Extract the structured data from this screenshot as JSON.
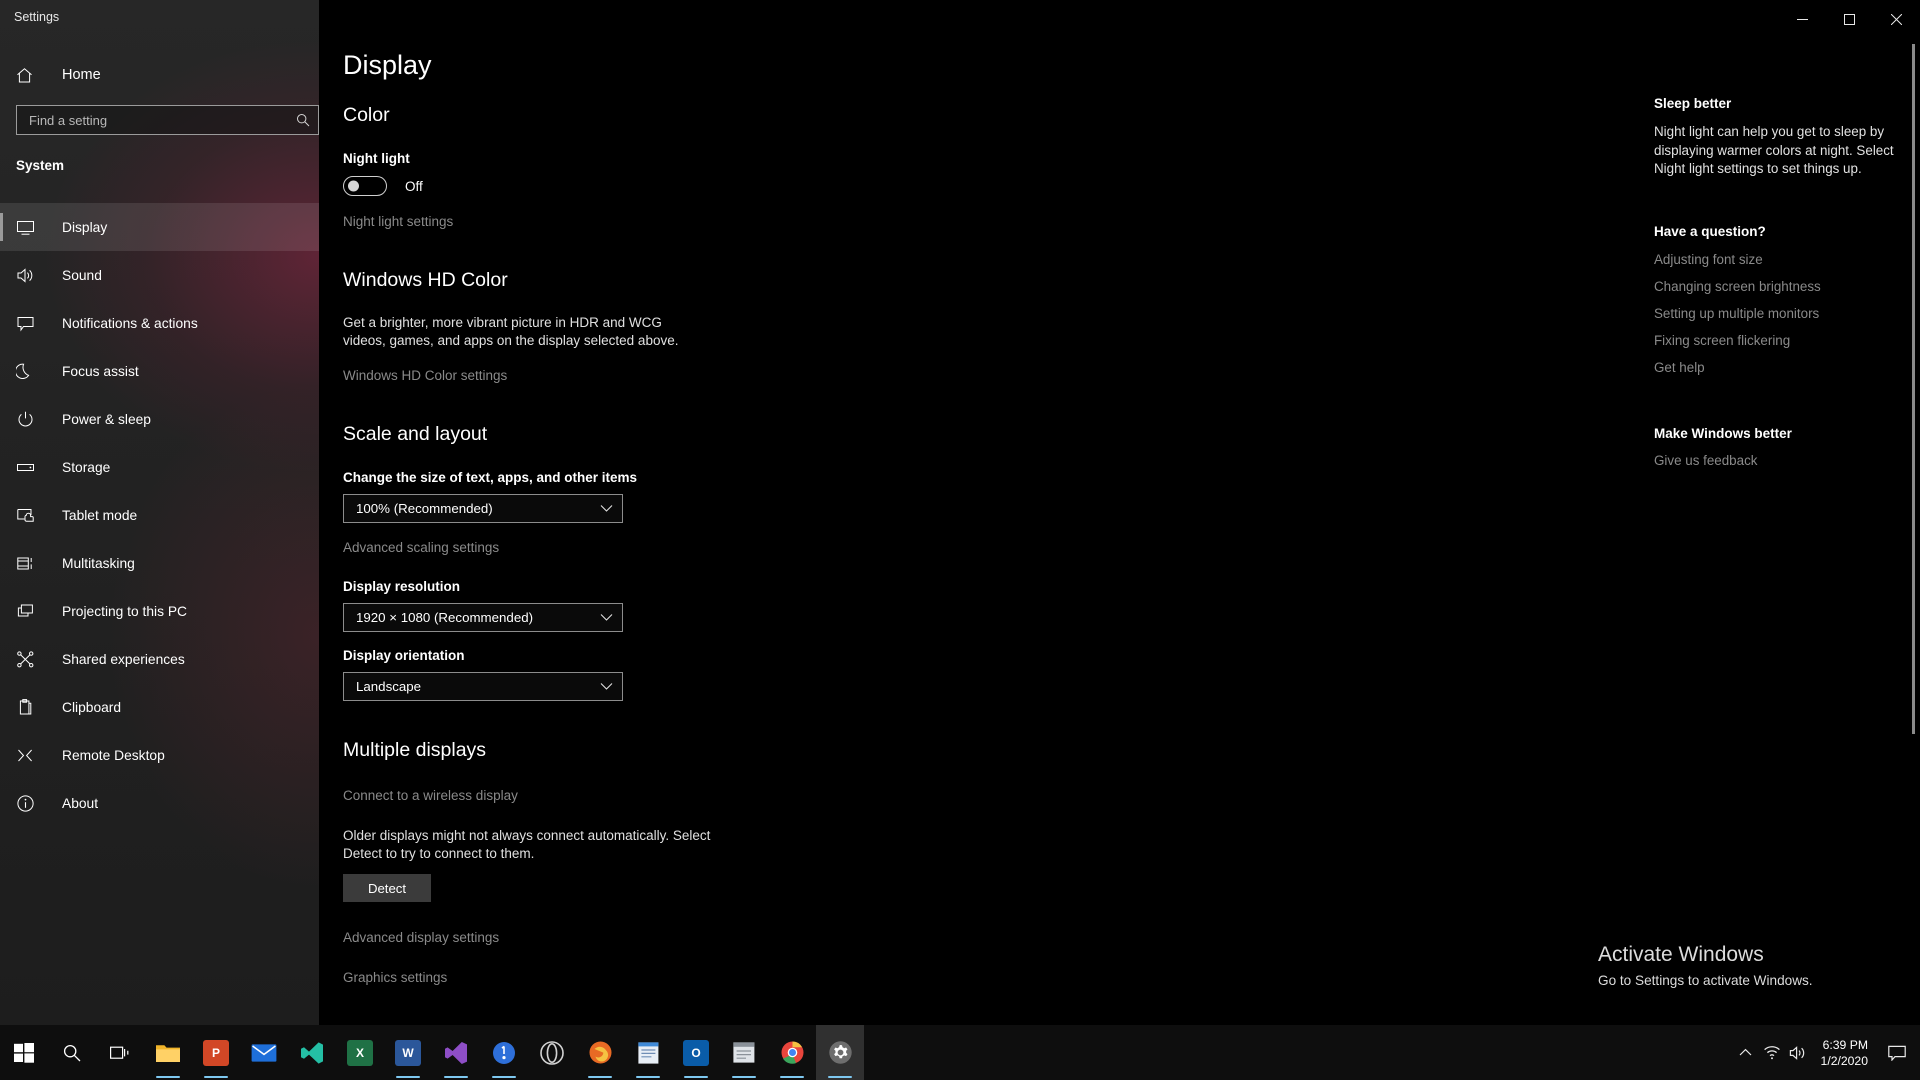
{
  "window": {
    "title": "Settings",
    "buttons": {
      "minimize": "minimize-icon",
      "maximize": "maximize-icon",
      "close": "close-icon"
    }
  },
  "sidebar": {
    "home_label": "Home",
    "home_icon": "home-icon",
    "search": {
      "placeholder": "Find a setting",
      "value": "",
      "icon": "search-icon"
    },
    "group_header": "System",
    "items": [
      {
        "label": "Display",
        "icon": "monitor-icon",
        "selected": true
      },
      {
        "label": "Sound",
        "icon": "speaker-icon",
        "selected": false
      },
      {
        "label": "Notifications & actions",
        "icon": "notification-icon",
        "selected": false
      },
      {
        "label": "Focus assist",
        "icon": "moon-icon",
        "selected": false
      },
      {
        "label": "Power & sleep",
        "icon": "power-icon",
        "selected": false
      },
      {
        "label": "Storage",
        "icon": "storage-icon",
        "selected": false
      },
      {
        "label": "Tablet mode",
        "icon": "tablet-icon",
        "selected": false
      },
      {
        "label": "Multitasking",
        "icon": "multitasking-icon",
        "selected": false
      },
      {
        "label": "Projecting to this PC",
        "icon": "projecting-icon",
        "selected": false
      },
      {
        "label": "Shared experiences",
        "icon": "shared-icon",
        "selected": false
      },
      {
        "label": "Clipboard",
        "icon": "clipboard-icon",
        "selected": false
      },
      {
        "label": "Remote Desktop",
        "icon": "remote-desktop-icon",
        "selected": false
      },
      {
        "label": "About",
        "icon": "info-icon",
        "selected": false
      }
    ]
  },
  "main": {
    "page_title": "Display",
    "color": {
      "heading": "Color",
      "night_light_label": "Night light",
      "night_light_state": "Off",
      "night_light_on": false,
      "settings_link": "Night light settings"
    },
    "hd_color": {
      "heading": "Windows HD Color",
      "description": "Get a brighter, more vibrant picture in HDR and WCG videos, games, and apps on the display selected above.",
      "settings_link": "Windows HD Color settings"
    },
    "scale_layout": {
      "heading": "Scale and layout",
      "scale_label": "Change the size of text, apps, and other items",
      "scale_value": "100% (Recommended)",
      "advanced_link": "Advanced scaling settings",
      "resolution_label": "Display resolution",
      "resolution_value": "1920 × 1080 (Recommended)",
      "orientation_label": "Display orientation",
      "orientation_value": "Landscape"
    },
    "multiple_displays": {
      "heading": "Multiple displays",
      "wireless_link": "Connect to a wireless display",
      "detect_description": "Older displays might not always connect automatically. Select Detect to try to connect to them.",
      "detect_button": "Detect",
      "advanced_display_link": "Advanced display settings",
      "graphics_link": "Graphics settings"
    }
  },
  "rail": {
    "sleep_better": {
      "heading": "Sleep better",
      "text": "Night light can help you get to sleep by displaying warmer colors at night. Select Night light settings to set things up."
    },
    "question": {
      "heading": "Have a question?",
      "links": [
        "Adjusting font size",
        "Changing screen brightness",
        "Setting up multiple monitors",
        "Fixing screen flickering",
        "Get help"
      ]
    },
    "feedback": {
      "heading": "Make Windows better",
      "link": "Give us feedback"
    }
  },
  "watermark": {
    "line1": "Activate Windows",
    "line2": "Go to Settings to activate Windows."
  },
  "taskbar": {
    "start_icon": "windows-start-icon",
    "search_icon": "search-icon",
    "task_view_icon": "task-view-icon",
    "apps": [
      {
        "name": "File Explorer",
        "icon": "folder-icon",
        "color": "#e8b130",
        "glyph": "",
        "running": true
      },
      {
        "name": "PowerPoint",
        "icon": "powerpoint-icon",
        "color": "#d24726",
        "glyph": "P",
        "running": true
      },
      {
        "name": "Mail",
        "icon": "mail-icon",
        "color": "#1e6fd9",
        "glyph": "",
        "running": false
      },
      {
        "name": "Visual Studio Code Insiders",
        "icon": "vscode-insiders-icon",
        "color": "#24bfa5",
        "glyph": "",
        "running": false
      },
      {
        "name": "Excel",
        "icon": "excel-icon",
        "color": "#1f7145",
        "glyph": "X",
        "running": false
      },
      {
        "name": "Word",
        "icon": "word-icon",
        "color": "#2b579a",
        "glyph": "W",
        "running": false
      },
      {
        "name": "Visual Studio",
        "icon": "visual-studio-icon",
        "color": "#8e4ec6",
        "glyph": "",
        "running": true
      },
      {
        "name": "1Password",
        "icon": "onepassword-icon",
        "color": "#2e6fd9",
        "glyph": "",
        "running": true
      },
      {
        "name": "Opera",
        "icon": "opera-icon",
        "color": "#c9c9c9",
        "glyph": "",
        "running": false
      },
      {
        "name": "Firefox",
        "icon": "firefox-icon",
        "color": "#e86a24",
        "glyph": "",
        "running": true
      },
      {
        "name": "Notepad",
        "icon": "notepad-icon",
        "color": "#3f8ad8",
        "glyph": "",
        "running": true
      },
      {
        "name": "Outlook",
        "icon": "outlook-icon",
        "color": "#0a5ca8",
        "glyph": "O",
        "running": true
      },
      {
        "name": "Sticky Notes",
        "icon": "sticky-notes-icon",
        "color": "#5c5c5c",
        "glyph": "",
        "running": true
      },
      {
        "name": "Chrome",
        "icon": "chrome-icon",
        "color": "#3d8bf2",
        "glyph": "",
        "running": true
      },
      {
        "name": "Settings",
        "icon": "gear-icon",
        "color": "#6e6e6e",
        "glyph": "",
        "running": true
      }
    ],
    "tray": {
      "chevron_icon": "chevron-up-icon",
      "network_icon": "wifi-icon",
      "volume_icon": "volume-icon",
      "time": "6:39 PM",
      "date": "1/2/2020",
      "action_center_icon": "action-center-icon"
    }
  }
}
